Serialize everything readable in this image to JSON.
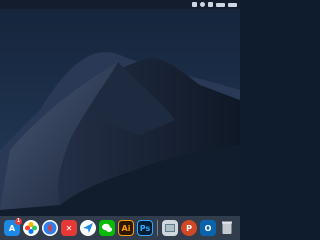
{
  "desktop": {
    "wallpaper": "mojave-dark-dunes"
  },
  "menubar": {
    "status_icons": [
      "spotlight-icon",
      "siri-icon",
      "notification-icon",
      "wifi-icon",
      "battery-icon"
    ]
  },
  "dock": {
    "app_store_badge": "1",
    "adobe_illustrator_label": "Ai",
    "adobe_photoshop_label": "Ps"
  }
}
